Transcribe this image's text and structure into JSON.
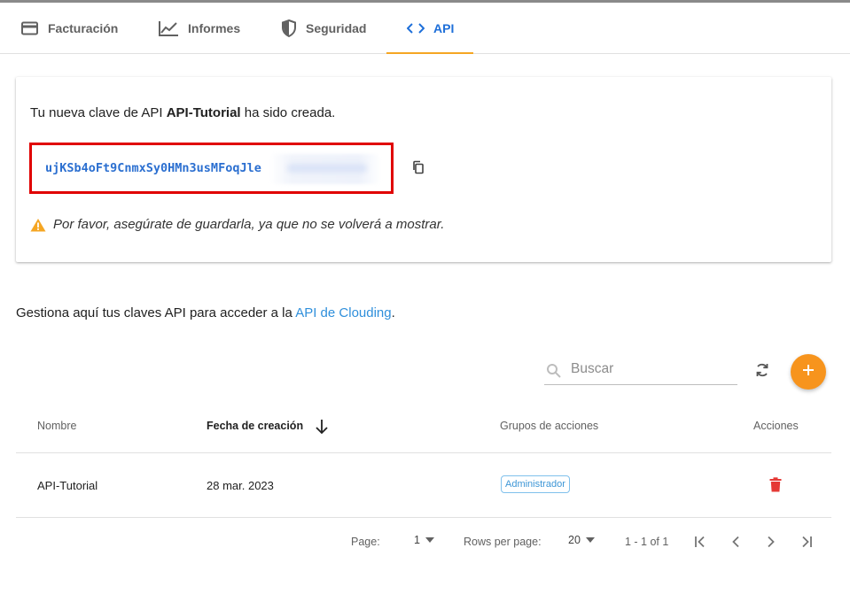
{
  "tabs": [
    {
      "label": "Facturación",
      "icon": "credit-card-icon"
    },
    {
      "label": "Informes",
      "icon": "chart-line-icon"
    },
    {
      "label": "Seguridad",
      "icon": "shield-icon"
    },
    {
      "label": "API",
      "icon": "code-icon",
      "active": true
    }
  ],
  "card": {
    "message_prefix": "Tu nueva clave de API ",
    "key_name": "API-Tutorial",
    "message_suffix": " ha sido creada.",
    "api_key_visible": "ujKSb4oFt9CnmxSy0HMn3usMFoqJle",
    "warning": "Por favor, asegúrate de guardarla, ya que no se volverá a mostrar."
  },
  "description": {
    "prefix": "Gestiona aquí tus claves API para acceder a la ",
    "link": "API de Clouding",
    "suffix": "."
  },
  "search": {
    "placeholder": "Buscar"
  },
  "table": {
    "headers": {
      "name": "Nombre",
      "created": "Fecha de creación",
      "groups": "Grupos de acciones",
      "actions": "Acciones"
    },
    "rows": [
      {
        "name": "API-Tutorial",
        "created": "28 mar. 2023",
        "group": "Administrador"
      }
    ]
  },
  "pagination": {
    "page_label": "Page:",
    "page_value": "1",
    "rows_label": "Rows per page:",
    "rows_value": "20",
    "range": "1 - 1 of 1"
  },
  "colors": {
    "accent": "#1e6fd9",
    "tab_indicator": "#f5a623",
    "add_button": "#f7941d",
    "highlight_border": "#e00000",
    "delete": "#e53935",
    "warning": "#f5a623"
  }
}
